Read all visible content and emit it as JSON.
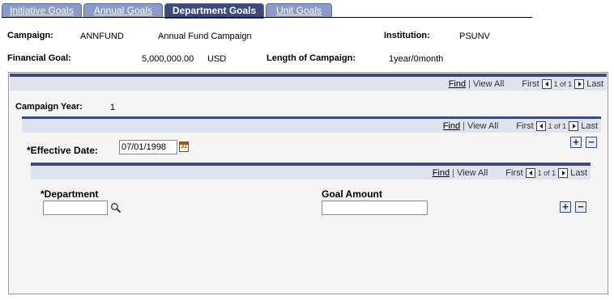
{
  "tabs": [
    {
      "label": "Initiative Goals",
      "active": false
    },
    {
      "label": "Annual Goals",
      "active": false
    },
    {
      "label": "Department Goals",
      "active": true
    },
    {
      "label": "Unit Goals",
      "active": false
    }
  ],
  "header": {
    "campaign_label": "Campaign:",
    "campaign_code": "ANNFUND",
    "campaign_name": "Annual Fund Campaign",
    "institution_label": "Institution:",
    "institution_value": "PSUNV",
    "financial_goal_label": "Financial Goal:",
    "financial_goal_value": "5,000,000.00",
    "financial_goal_currency": "USD",
    "length_label": "Length of Campaign:",
    "length_value": "1year/0month"
  },
  "nav": {
    "find": "Find",
    "view_all": "View All",
    "first": "First",
    "page_of": "1 of 1",
    "last": "Last"
  },
  "campaign_year": {
    "label": "Campaign Year:",
    "value": "1"
  },
  "effective_date": {
    "label": "*Effective Date:",
    "value": "07/01/1998",
    "calendar_glyph": "31"
  },
  "department": {
    "label": "*Department",
    "value": "",
    "goal_amount_label": "Goal Amount",
    "goal_amount_value": ""
  },
  "buttons": {
    "add": "+",
    "remove": "−"
  },
  "colors": {
    "accent": "#3c4b7c",
    "tab_inactive": "#8b9bc7",
    "nav_strip": "#dfe3ef"
  }
}
